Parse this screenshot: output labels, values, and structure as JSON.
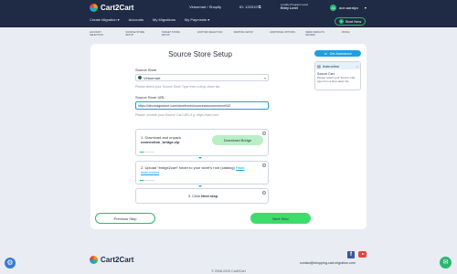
{
  "header": {
    "logo_text": "Cart2Cart",
    "nav": [
      "Create Migration",
      "Accounts",
      "My Migrations",
      "My Payments"
    ],
    "store": "Virtuemart / Shopify",
    "id_label": "ID: 122019",
    "loyalty_title": "Loyalty Program Level",
    "loyalty_level": "Entry Level",
    "user_initials": "AS",
    "user_name": "aun.aaralyo",
    "start_new": "Start New"
  },
  "steps": [
    "Account Selection",
    "Source Store Setup",
    "Target Store Setup",
    "Entities Selection",
    "Mapping Setup",
    "Additional Options",
    "Demo Results Review",
    "Finish"
  ],
  "main": {
    "title": "Source Store Setup",
    "source_store_label": "Source Store",
    "source_store_value": "Virtuemart",
    "source_store_hint": "Please select your Source Store Type from a drop-down list.",
    "url_label": "Source Store URL",
    "url_value": "https://dev.magestore.com/storefronts/sourcewoocommerce042",
    "url_hint": "Please, provide your Source Cart URL e.g. https://cart.com",
    "step1_text": "1. Download and unpack",
    "step1_bold": "connection_bridge.zip",
    "download_button": "Download Bridge",
    "step2_text": "2. Upload “bridge2cart” folder to your store's root (catalog)",
    "step2_link": "Read instructions",
    "step3_text": "3. Click",
    "step3_bold": "Next step",
    "prev_button": "Previous Step",
    "next_button": "Next Step",
    "bridge_progress": 0.25
  },
  "assistance": {
    "button": "Get Assistance",
    "panel_title": "Instruction",
    "source_cart": "Source Cart",
    "description": "Please select your Source Cart type from a drop-down list"
  },
  "footer": {
    "logo_text": "Cart2Cart",
    "contact": "contact@shopping-cart-migration.com",
    "copyright": "© 2008-2025 Cart2Cart"
  },
  "icons": [
    "gear-icon",
    "chat-icon",
    "facebook-icon",
    "youtube-icon",
    "info-icon"
  ]
}
